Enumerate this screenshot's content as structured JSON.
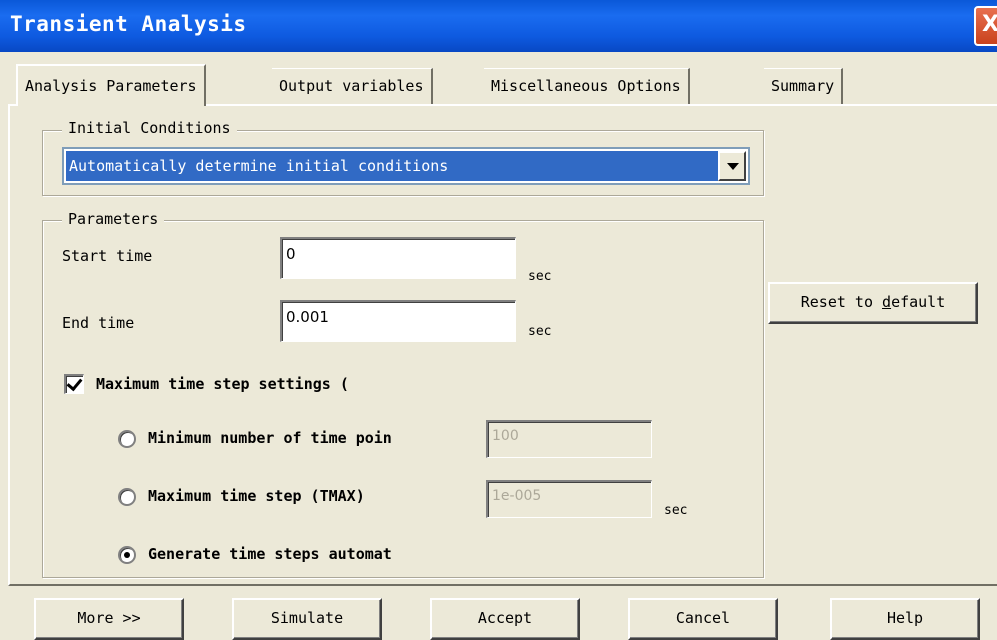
{
  "window": {
    "title": "Transient Analysis",
    "close_glyph": "X"
  },
  "tabs": [
    {
      "label": "Analysis Parameters",
      "active": true
    },
    {
      "label": "Output variables",
      "active": false
    },
    {
      "label": "Miscellaneous Options",
      "active": false
    },
    {
      "label": "Summary",
      "active": false
    }
  ],
  "initial_conditions": {
    "group_label": "Initial Conditions",
    "selected": "Automatically determine initial conditions"
  },
  "parameters": {
    "group_label": "Parameters",
    "start_time": {
      "label": "Start time",
      "value": "0",
      "unit": "sec"
    },
    "end_time": {
      "label": "End time",
      "value": "0.001",
      "unit": "sec"
    },
    "max_step_settings": {
      "label": "Maximum time step settings (",
      "checked": true
    },
    "min_points": {
      "label": "Minimum number of time poin",
      "value": "100",
      "selected": false
    },
    "max_step": {
      "label": "Maximum time step (TMAX)",
      "value": "1e-005",
      "unit": "sec",
      "selected": false
    },
    "auto_steps": {
      "label": "Generate time steps automat",
      "selected": true
    }
  },
  "reset_button": {
    "label_pre": "Reset to ",
    "label_underlined": "d",
    "label_post": "efault"
  },
  "footer_buttons": {
    "more": "More >>",
    "simulate": "Simulate",
    "accept": "Accept",
    "cancel": "Cancel",
    "help": "Help"
  }
}
